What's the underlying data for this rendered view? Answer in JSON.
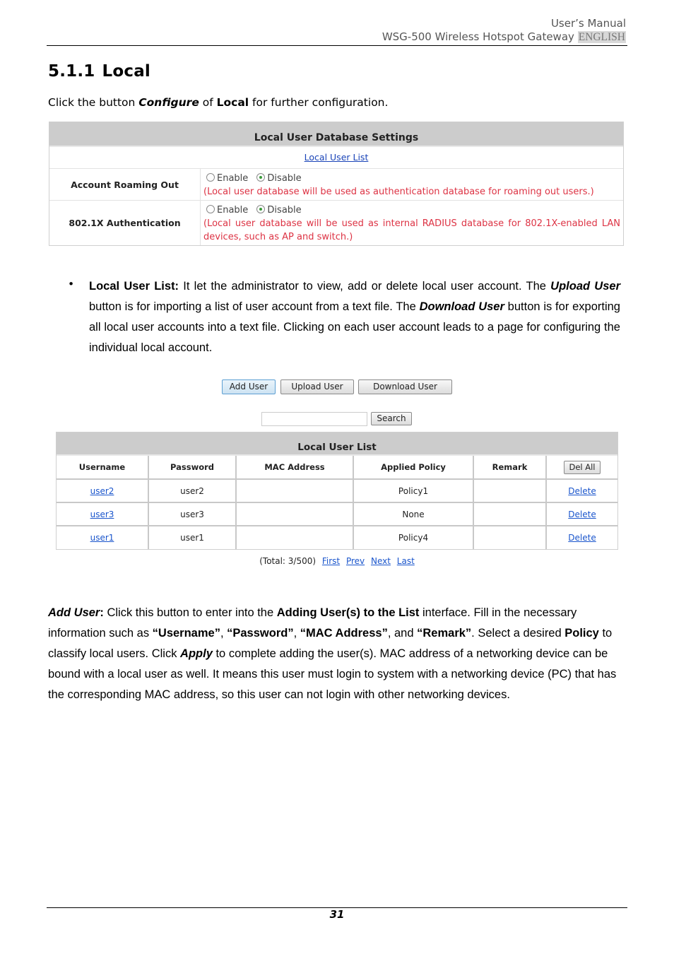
{
  "header": {
    "line1": "User’s Manual",
    "line2": "WSG-500 Wireless Hotspot Gateway",
    "language": "ENGLISH"
  },
  "section": {
    "number": "5.1.1",
    "title": "Local",
    "intro": {
      "prefix": "Click the button ",
      "configure": "Configure",
      "of": " of ",
      "local": "Local",
      "suffix": " for further configuration."
    }
  },
  "settings_panel": {
    "title": "Local User Database Settings",
    "link": "Local User List",
    "rows": [
      {
        "label": "Account Roaming Out",
        "options": [
          "Enable",
          "Disable"
        ],
        "selected": "Disable",
        "note": "(Local user database will be used as authentication database for roaming out users.)"
      },
      {
        "label": "802.1X Authentication",
        "options": [
          "Enable",
          "Disable"
        ],
        "selected": "Disable",
        "note": "(Local user database will be used as internal RADIUS database for 802.1X-enabled LAN devices, such as AP and switch.)"
      }
    ]
  },
  "bullet_paragraph": {
    "bullet": "•",
    "lead": "Local User List:",
    "t1": " It let the administrator to view, add or delete local user account. The ",
    "upload": "Upload User",
    "t2": " button is for importing a list of user account from a text file. The ",
    "download": "Download User",
    "t3": " button is for exporting all local user accounts into a text file. Clicking on each user account leads to a page for configuring the individual local account."
  },
  "toolbar": {
    "add_user": "Add User",
    "upload_user": "Upload User",
    "download_user": "Download User",
    "search_value": "",
    "search": "Search"
  },
  "user_list": {
    "title": "Local User List",
    "columns": [
      "Username",
      "Password",
      "MAC Address",
      "Applied Policy",
      "Remark"
    ],
    "del_all": "Del All",
    "rows": [
      {
        "username": "user2",
        "password": "user2",
        "mac": "",
        "policy": "Policy1",
        "remark": "",
        "action": "Delete"
      },
      {
        "username": "user3",
        "password": "user3",
        "mac": "",
        "policy": "None",
        "remark": "",
        "action": "Delete"
      },
      {
        "username": "user1",
        "password": "user1",
        "mac": "",
        "policy": "Policy4",
        "remark": "",
        "action": "Delete"
      }
    ]
  },
  "pager": {
    "total": "(Total: 3/500)",
    "first": "First",
    "prev": "Prev",
    "next": "Next",
    "last": "Last"
  },
  "add_user_paragraph": {
    "lead": "Add User",
    "colon": ":",
    "t1": " Click this button to enter into the ",
    "adding": "Adding User(s) to the List",
    "t2": " interface. Fill in the necessary information such as ",
    "f1": "“Username”",
    "c1": ", ",
    "f2": "“Password”",
    "c2": ", ",
    "f3": "“MAC Address”",
    "c3": ", and ",
    "f4": "“Remark”",
    "t3": ". Select a desired ",
    "policy": "Policy",
    "t4": " to classify local users. Click ",
    "apply": "Apply",
    "t5": " to complete adding the user(s). MAC address of a networking device can be bound with a local user as well. It means this user must login to system with a networking device (PC) that has the corresponding MAC address, so this user can not login with other networking devices."
  },
  "footer": {
    "page_number": "31"
  }
}
